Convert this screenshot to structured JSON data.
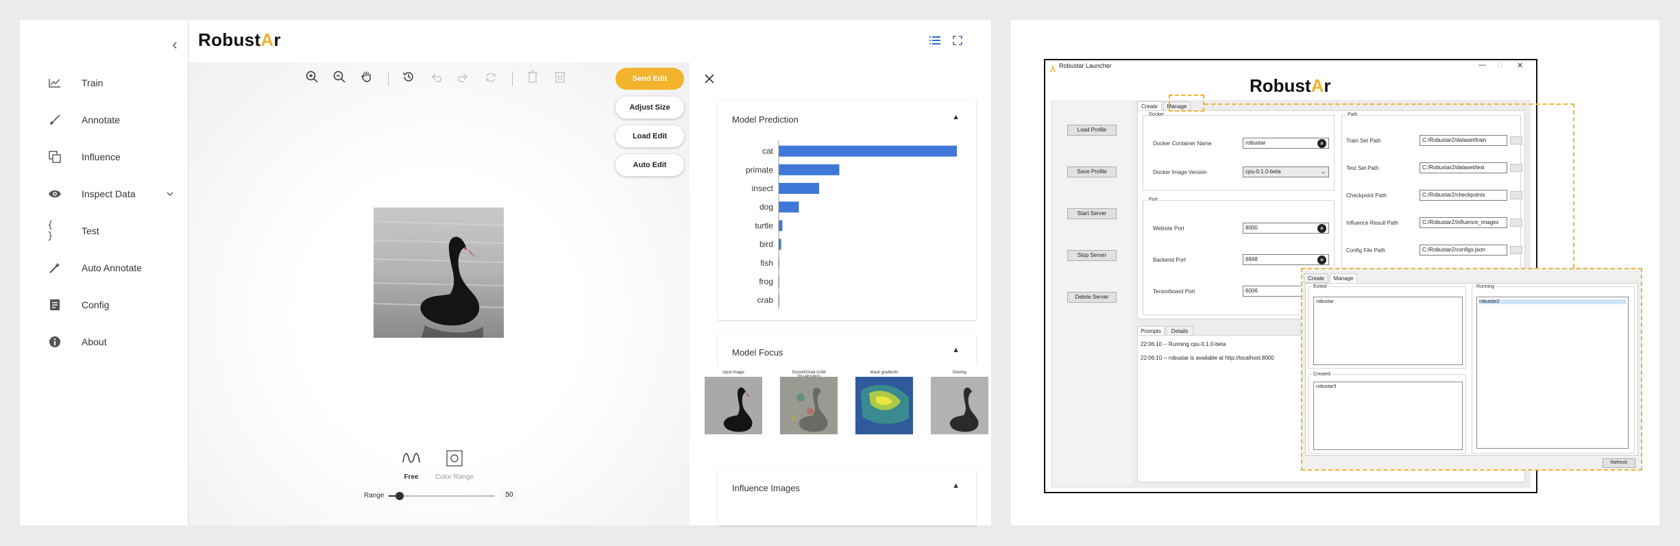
{
  "app": {
    "brand": {
      "text": "Robust",
      "star": "A",
      "suffix": "r"
    },
    "accent": "#f3b32d",
    "bar_color": "#3f78d8"
  },
  "sidebar": {
    "items": [
      {
        "label": "Train",
        "icon": "chart-line-icon"
      },
      {
        "label": "Annotate",
        "icon": "brush-icon"
      },
      {
        "label": "Influence",
        "icon": "copy-icon"
      },
      {
        "label": "Inspect Data",
        "icon": "eye-icon"
      },
      {
        "label": "Test",
        "icon": "braces-icon"
      },
      {
        "label": "Auto Annotate",
        "icon": "magic-wand-icon"
      },
      {
        "label": "Config",
        "icon": "document-icon"
      },
      {
        "label": "About",
        "icon": "info-icon"
      }
    ]
  },
  "editor": {
    "buttons": [
      "Send Edit",
      "Adjust Size",
      "Load Edit",
      "Auto Edit"
    ],
    "brushes": [
      "Free",
      "Color Range"
    ],
    "range_label": "Range",
    "range_value": "50",
    "range_fraction": 0.1
  },
  "right_panel": {
    "prediction_title": "Model Prediction",
    "focus_title": "Model Focus",
    "influence_title": "Influence Images",
    "focus_captions": [
      "Input Image",
      "SmoothGrad-CAM Visualization",
      "Mask gradients",
      "Overlay"
    ]
  },
  "chart_data": {
    "type": "bar",
    "orientation": "horizontal",
    "categories": [
      "cat",
      "primate",
      "insect",
      "dog",
      "turtle",
      "bird",
      "fish",
      "frog",
      "crab"
    ],
    "values": [
      0.5728,
      0.195,
      0.13,
      0.065,
      0.012,
      0.008,
      0.001,
      0.001,
      0.001
    ],
    "xlim": [
      0,
      0.5728
    ],
    "tick_labels": [
      "0",
      "0.5728"
    ]
  },
  "launcher": {
    "window_title": "Robustar Launcher",
    "logo": {
      "text": "Robust",
      "star": "A",
      "suffix": "r"
    },
    "side_buttons": [
      "Load Profile",
      "Save Profile",
      "Start Server",
      "Stop Server",
      "Delete Server"
    ],
    "tabs": [
      "Create",
      "Manage"
    ],
    "docker_group": "Docker",
    "docker_fields": [
      {
        "label": "Docker Container Name",
        "value": "robustar"
      },
      {
        "label": "Docker Image Version",
        "value": "cpu-0.1.0-beta"
      }
    ],
    "port_group": "Port",
    "port_fields": [
      {
        "label": "Website Port",
        "value": "8000"
      },
      {
        "label": "Backend Port",
        "value": "6848"
      },
      {
        "label": "Tensorboard Port",
        "value": "6006"
      }
    ],
    "path_group": "Path",
    "path_fields": [
      {
        "label": "Train Set Path",
        "value": "C:/Robustar2/dataset/train"
      },
      {
        "label": "Test Set Path",
        "value": "C:/Robustar2/dataset/test"
      },
      {
        "label": "Checkpoint Path",
        "value": "C:/Robustar2/checkpoints"
      },
      {
        "label": "Influence Result Path",
        "value": "C:/Robustar2/influence_images"
      },
      {
        "label": "Config File Path",
        "value": "C:/Robustar2/configs.json"
      }
    ],
    "bottom_tabs": [
      "Prompts",
      "Details"
    ],
    "log_lines": [
      "22:06:10 -- Running cpu-0.1.0-beta",
      "22:06:10 -- robustar is available at http://localhost:8000"
    ],
    "manage": {
      "tabs": [
        "Create",
        "Manage"
      ],
      "exited_label": "Exited",
      "exited_items": [
        "robustar"
      ],
      "created_label": "Created",
      "created_items": [
        "robustar3"
      ],
      "running_label": "Running",
      "running_items": [
        "robustar2"
      ],
      "refresh": "Refresh"
    }
  }
}
